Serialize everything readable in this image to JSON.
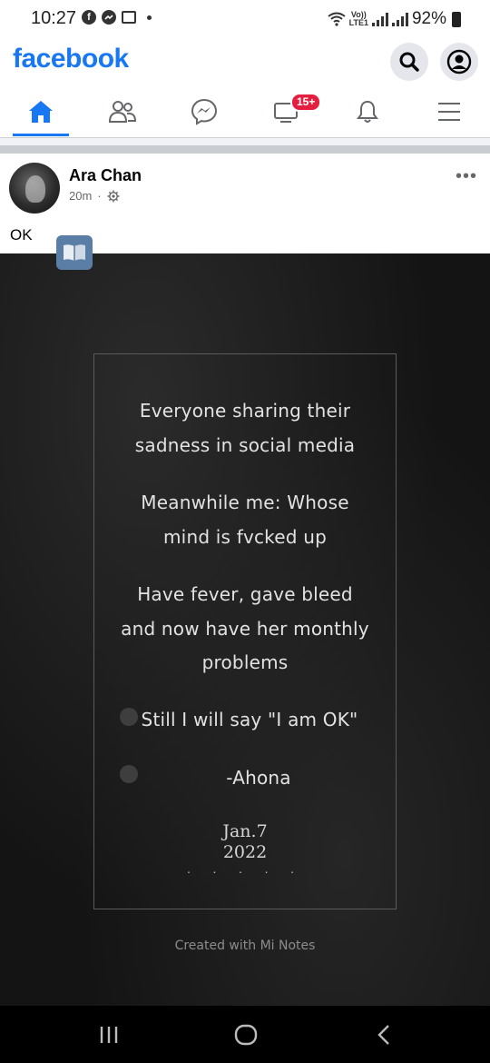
{
  "status_bar": {
    "time": "10:27",
    "volte_label_top": "Vo))",
    "volte_label_bottom": "LTE1",
    "battery": "92%",
    "facebook_icon_letter": "f"
  },
  "header": {
    "logo": "facebook",
    "brand_color": "#1877f2"
  },
  "nav": {
    "tabs": [
      {
        "name": "home",
        "icon": "home-icon",
        "active": true
      },
      {
        "name": "friends",
        "icon": "friends-icon"
      },
      {
        "name": "messenger",
        "icon": "messenger-icon"
      },
      {
        "name": "watch",
        "icon": "watch-icon",
        "badge": "15+"
      },
      {
        "name": "notifications",
        "icon": "bell-icon"
      },
      {
        "name": "menu",
        "icon": "hamburger-menu-icon"
      }
    ]
  },
  "post": {
    "author": "Ara Chan",
    "time": "20m",
    "separator": "·",
    "privacy_icon": "gear-icon",
    "more": "•••",
    "text": "OK",
    "image": {
      "lines": [
        "Everyone sharing their",
        "sadness in social media",
        "Meanwhile me: Whose",
        "mind is fvcked up",
        "Have fever, gave bleed",
        "and now have her monthly",
        "problems",
        "Still I will say \"I am OK\"",
        "-Ahona"
      ],
      "date_line1": "Jan.7",
      "date_line2": "2022",
      "dots": "· · · · ·",
      "watermark": "Created with Mi Notes"
    }
  },
  "colors": {
    "badge": "#e41e3f",
    "image_bg": "#141414"
  }
}
